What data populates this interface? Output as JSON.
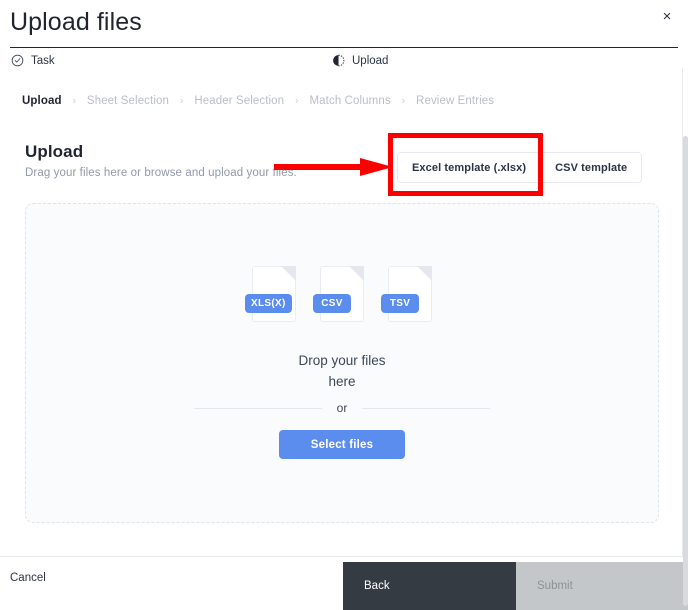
{
  "window": {
    "title": "Upload files",
    "close_label": "×",
    "close_icon": "close-icon"
  },
  "phases": [
    {
      "label": "Task",
      "icon": "check-circle-icon",
      "state": "complete"
    },
    {
      "label": "Upload",
      "icon": "half-circle-progress-icon",
      "state": "current"
    }
  ],
  "stepper": {
    "separator": "›",
    "steps": [
      {
        "label": "Upload",
        "active": true
      },
      {
        "label": "Sheet Selection",
        "active": false
      },
      {
        "label": "Header Selection",
        "active": false
      },
      {
        "label": "Match Columns",
        "active": false
      },
      {
        "label": "Review Entries",
        "active": false
      }
    ]
  },
  "upload_section": {
    "heading": "Upload",
    "subtitle": "Drag your files here or browse and upload your files.",
    "templates": [
      {
        "label": "Excel template (.xlsx)"
      },
      {
        "label": "CSV template"
      }
    ]
  },
  "dropzone": {
    "file_types": [
      {
        "tag": "XLS(X)",
        "icon": "xlsx-file-icon"
      },
      {
        "tag": "CSV",
        "icon": "csv-file-icon"
      },
      {
        "tag": "TSV",
        "icon": "tsv-file-icon"
      }
    ],
    "drop_line_1": "Drop your files",
    "drop_line_2": "here",
    "or_label": "or",
    "select_files_label": "Select files"
  },
  "footer": {
    "cancel_label": "Cancel",
    "back_label": "Back",
    "submit_label": "Submit"
  },
  "annotation": {
    "type": "red-highlight-box-with-arrow",
    "target": "Excel template (.xlsx)"
  },
  "colors": {
    "accent_blue": "#5b8def",
    "annotation_red": "#fc0000",
    "back_dark": "#343b43",
    "submit_disabled": "#c4c7ca",
    "muted_text": "#b9bec9"
  }
}
